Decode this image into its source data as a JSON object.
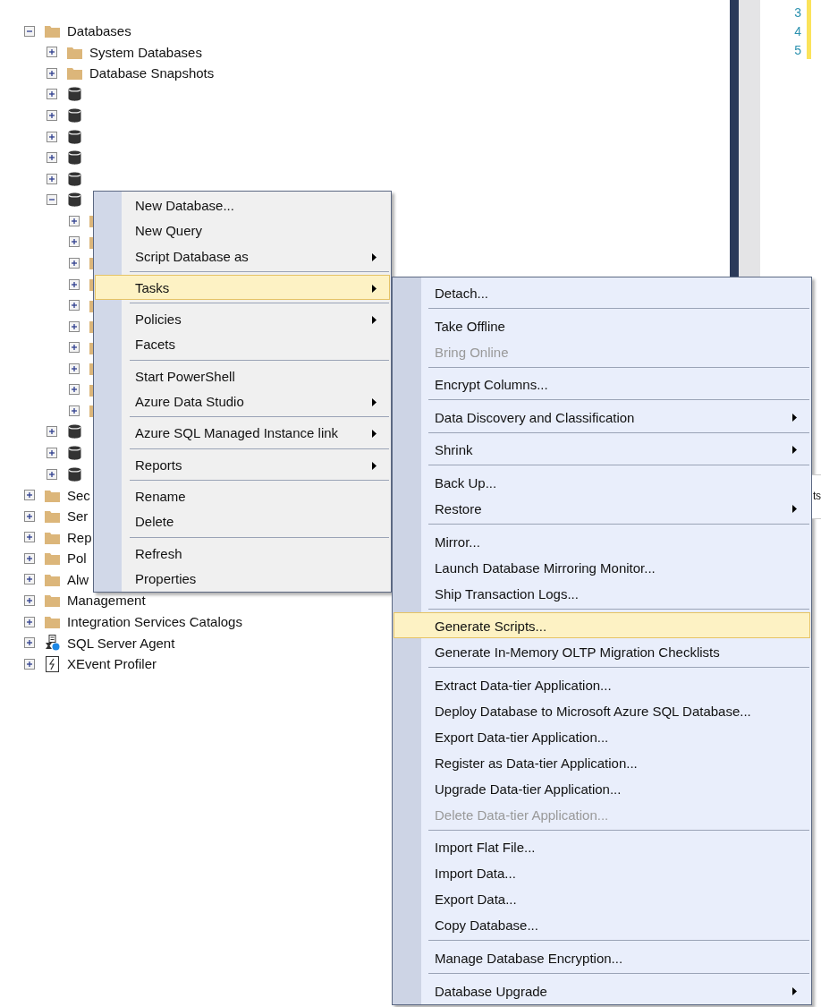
{
  "tree": [
    {
      "label": "Databases",
      "kind": "folder",
      "expanded": true,
      "children": [
        {
          "label": "System Databases",
          "kind": "folder",
          "expanded": false
        },
        {
          "label": "Database Snapshots",
          "kind": "folder",
          "expanded": false
        },
        {
          "kind": "database",
          "expanded": false
        },
        {
          "kind": "database",
          "expanded": false
        },
        {
          "kind": "database",
          "expanded": false
        },
        {
          "kind": "database",
          "expanded": false
        },
        {
          "kind": "database",
          "expanded": false
        },
        {
          "kind": "database",
          "expanded": true,
          "children": [
            {
              "kind": "folder",
              "expanded": false
            },
            {
              "kind": "folder",
              "expanded": false
            },
            {
              "kind": "folder",
              "expanded": false
            },
            {
              "kind": "folder",
              "expanded": false
            },
            {
              "kind": "folder",
              "expanded": false
            },
            {
              "kind": "folder",
              "expanded": false
            },
            {
              "kind": "folder",
              "expanded": false
            },
            {
              "kind": "folder",
              "expanded": false
            },
            {
              "kind": "folder",
              "expanded": false
            },
            {
              "kind": "folder",
              "expanded": false
            }
          ]
        },
        {
          "kind": "database",
          "expanded": false
        },
        {
          "kind": "database",
          "expanded": false
        },
        {
          "kind": "database",
          "expanded": false
        }
      ]
    },
    {
      "label": "Sec",
      "kind": "folder",
      "expanded": false
    },
    {
      "label": "Ser",
      "kind": "folder",
      "expanded": false
    },
    {
      "label": "Rep",
      "kind": "folder",
      "expanded": false
    },
    {
      "label": "Pol",
      "kind": "folder",
      "expanded": false
    },
    {
      "label": "Alw",
      "kind": "folder",
      "expanded": false
    },
    {
      "label": "Management",
      "kind": "folder",
      "expanded": false
    },
    {
      "label": "Integration Services Catalogs",
      "kind": "folder",
      "expanded": false
    },
    {
      "label": "SQL Server Agent",
      "kind": "agent",
      "expanded": false
    },
    {
      "label": "XEvent Profiler",
      "kind": "profiler",
      "expanded": false
    }
  ],
  "editor": {
    "line_numbers": [
      "3",
      "4",
      "5"
    ],
    "side_text": "ts"
  },
  "context_menu": [
    {
      "kind": "item",
      "label": "New Database...",
      "selected": false,
      "disabled": false,
      "submenu": false
    },
    {
      "kind": "item",
      "label": "New Query",
      "selected": false,
      "disabled": false,
      "submenu": false
    },
    {
      "kind": "item",
      "label": "Script Database as",
      "selected": false,
      "disabled": false,
      "submenu": true
    },
    {
      "kind": "separator"
    },
    {
      "kind": "item",
      "label": "Tasks",
      "selected": true,
      "disabled": false,
      "submenu": true
    },
    {
      "kind": "separator"
    },
    {
      "kind": "item",
      "label": "Policies",
      "selected": false,
      "disabled": false,
      "submenu": true
    },
    {
      "kind": "item",
      "label": "Facets",
      "selected": false,
      "disabled": false,
      "submenu": false
    },
    {
      "kind": "separator"
    },
    {
      "kind": "item",
      "label": "Start PowerShell",
      "selected": false,
      "disabled": false,
      "submenu": false
    },
    {
      "kind": "item",
      "label": "Azure Data Studio",
      "selected": false,
      "disabled": false,
      "submenu": true
    },
    {
      "kind": "separator"
    },
    {
      "kind": "item",
      "label": "Azure SQL Managed Instance link",
      "selected": false,
      "disabled": false,
      "submenu": true
    },
    {
      "kind": "separator"
    },
    {
      "kind": "item",
      "label": "Reports",
      "selected": false,
      "disabled": false,
      "submenu": true
    },
    {
      "kind": "separator"
    },
    {
      "kind": "item",
      "label": "Rename",
      "selected": false,
      "disabled": false,
      "submenu": false
    },
    {
      "kind": "item",
      "label": "Delete",
      "selected": false,
      "disabled": false,
      "submenu": false
    },
    {
      "kind": "separator"
    },
    {
      "kind": "item",
      "label": "Refresh",
      "selected": false,
      "disabled": false,
      "submenu": false
    },
    {
      "kind": "item",
      "label": "Properties",
      "selected": false,
      "disabled": false,
      "submenu": false
    }
  ],
  "tasks_submenu": [
    {
      "kind": "item",
      "label": "Detach...",
      "selected": false,
      "disabled": false,
      "submenu": false
    },
    {
      "kind": "separator"
    },
    {
      "kind": "item",
      "label": "Take Offline",
      "selected": false,
      "disabled": false,
      "submenu": false
    },
    {
      "kind": "item",
      "label": "Bring Online",
      "selected": false,
      "disabled": true,
      "submenu": false
    },
    {
      "kind": "separator"
    },
    {
      "kind": "item",
      "label": "Encrypt Columns...",
      "selected": false,
      "disabled": false,
      "submenu": false
    },
    {
      "kind": "separator"
    },
    {
      "kind": "item",
      "label": "Data Discovery and Classification",
      "selected": false,
      "disabled": false,
      "submenu": true
    },
    {
      "kind": "separator"
    },
    {
      "kind": "item",
      "label": "Shrink",
      "selected": false,
      "disabled": false,
      "submenu": true
    },
    {
      "kind": "separator"
    },
    {
      "kind": "item",
      "label": "Back Up...",
      "selected": false,
      "disabled": false,
      "submenu": false
    },
    {
      "kind": "item",
      "label": "Restore",
      "selected": false,
      "disabled": false,
      "submenu": true
    },
    {
      "kind": "separator"
    },
    {
      "kind": "item",
      "label": "Mirror...",
      "selected": false,
      "disabled": false,
      "submenu": false
    },
    {
      "kind": "item",
      "label": "Launch Database Mirroring Monitor...",
      "selected": false,
      "disabled": false,
      "submenu": false
    },
    {
      "kind": "item",
      "label": "Ship Transaction Logs...",
      "selected": false,
      "disabled": false,
      "submenu": false
    },
    {
      "kind": "separator"
    },
    {
      "kind": "item",
      "label": "Generate Scripts...",
      "selected": true,
      "disabled": false,
      "submenu": false
    },
    {
      "kind": "item",
      "label": "Generate In-Memory OLTP Migration Checklists",
      "selected": false,
      "disabled": false,
      "submenu": false
    },
    {
      "kind": "separator"
    },
    {
      "kind": "item",
      "label": "Extract Data-tier Application...",
      "selected": false,
      "disabled": false,
      "submenu": false
    },
    {
      "kind": "item",
      "label": "Deploy Database to Microsoft Azure SQL Database...",
      "selected": false,
      "disabled": false,
      "submenu": false
    },
    {
      "kind": "item",
      "label": "Export Data-tier Application...",
      "selected": false,
      "disabled": false,
      "submenu": false
    },
    {
      "kind": "item",
      "label": "Register as Data-tier Application...",
      "selected": false,
      "disabled": false,
      "submenu": false
    },
    {
      "kind": "item",
      "label": "Upgrade Data-tier Application...",
      "selected": false,
      "disabled": false,
      "submenu": false
    },
    {
      "kind": "item",
      "label": "Delete Data-tier Application...",
      "selected": false,
      "disabled": true,
      "submenu": false
    },
    {
      "kind": "separator"
    },
    {
      "kind": "item",
      "label": "Import Flat File...",
      "selected": false,
      "disabled": false,
      "submenu": false
    },
    {
      "kind": "item",
      "label": "Import Data...",
      "selected": false,
      "disabled": false,
      "submenu": false
    },
    {
      "kind": "item",
      "label": "Export Data...",
      "selected": false,
      "disabled": false,
      "submenu": false
    },
    {
      "kind": "item",
      "label": "Copy Database...",
      "selected": false,
      "disabled": false,
      "submenu": false
    },
    {
      "kind": "separator"
    },
    {
      "kind": "item",
      "label": "Manage Database Encryption...",
      "selected": false,
      "disabled": false,
      "submenu": false
    },
    {
      "kind": "separator"
    },
    {
      "kind": "item",
      "label": "Database Upgrade",
      "selected": false,
      "disabled": false,
      "submenu": true
    }
  ]
}
